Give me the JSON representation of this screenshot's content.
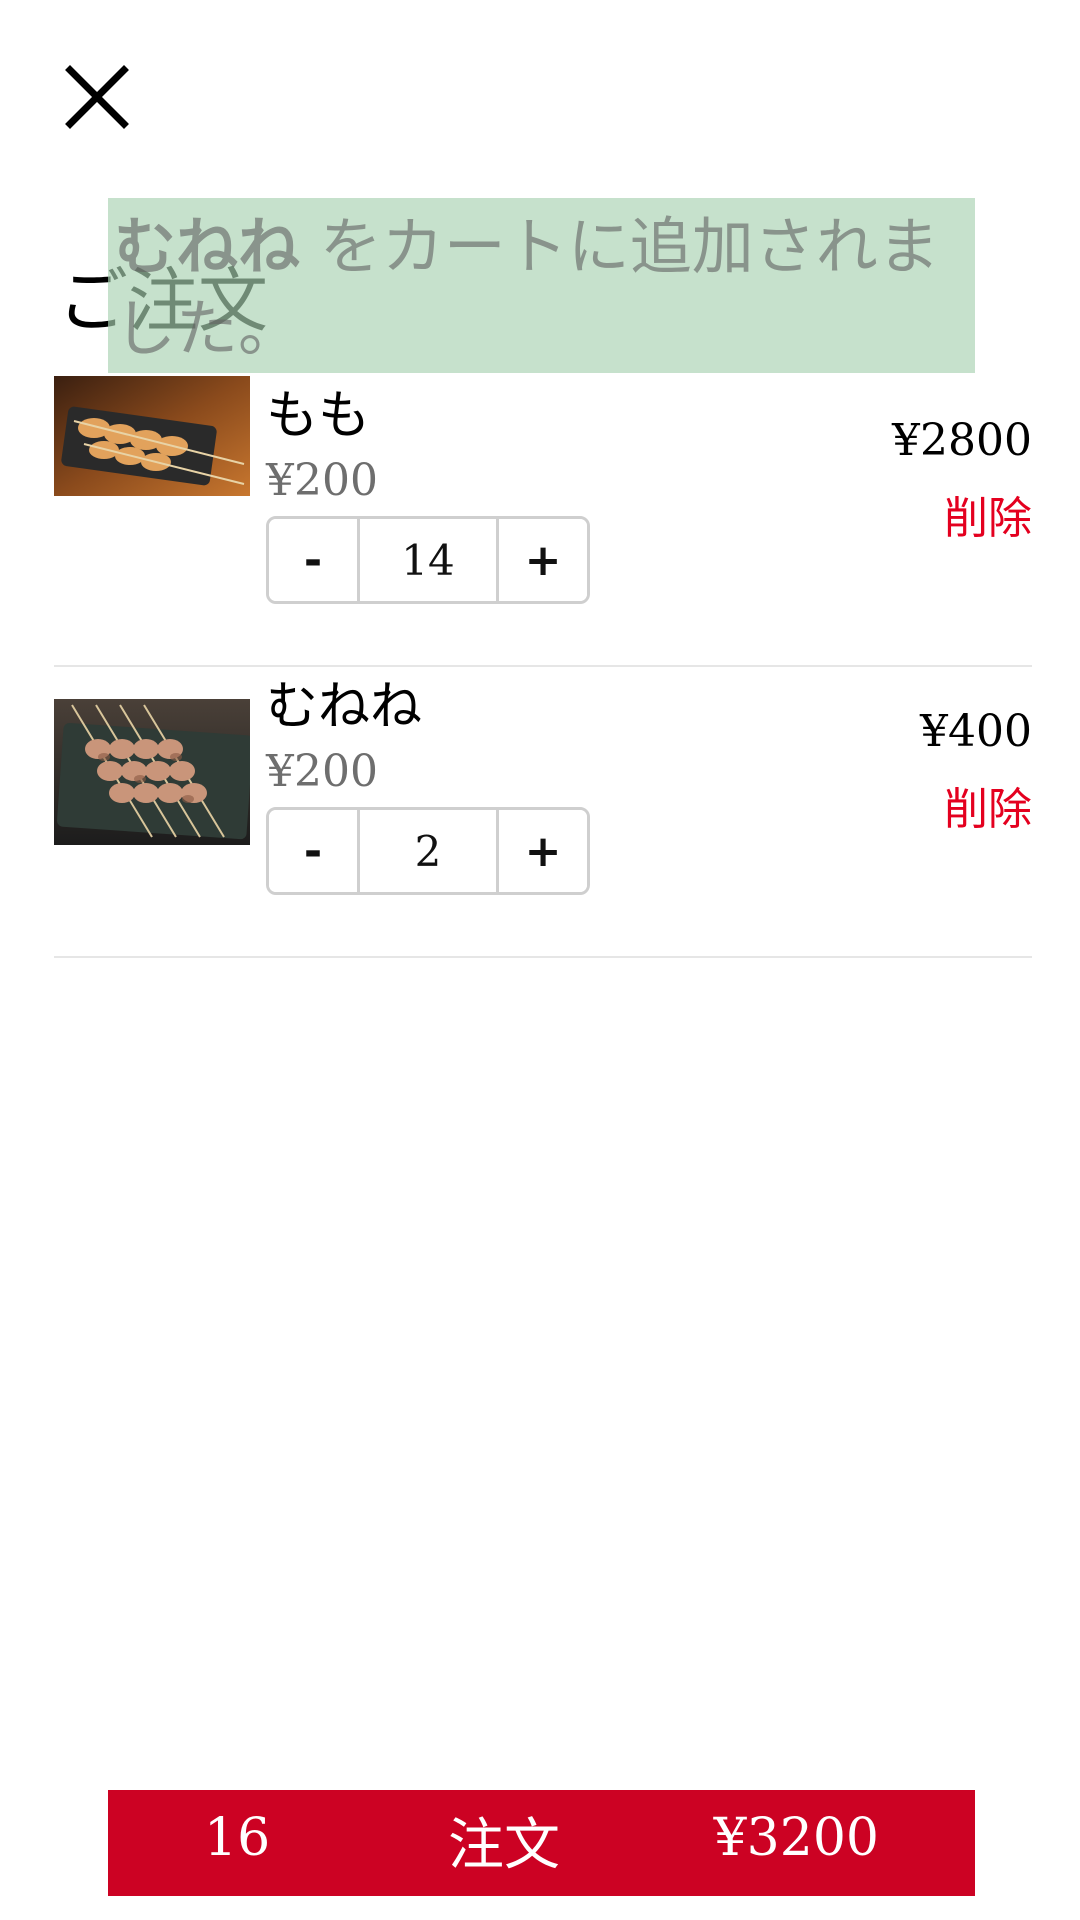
{
  "header": {
    "close_icon": "close-icon",
    "title": "ご注文"
  },
  "toast": {
    "item_name": "むねね",
    "message": " をカートに追加されました。",
    "background": "#a8d2b2"
  },
  "cart": {
    "items": [
      {
        "name": "もも",
        "unit_price": "¥200",
        "quantity": "14",
        "minus_label": "-",
        "plus_label": "+",
        "line_total": "¥2800",
        "delete_label": "削除",
        "image": "yakitori-momo-photo"
      },
      {
        "name": "むねね",
        "unit_price": "¥200",
        "quantity": "2",
        "minus_label": "-",
        "plus_label": "+",
        "line_total": "¥400",
        "delete_label": "削除",
        "image": "yakitori-mune-photo"
      }
    ]
  },
  "checkout": {
    "count": "16",
    "label": "注文",
    "total": "¥3200",
    "background": "#cc0223"
  },
  "colors": {
    "accent": "#cc0223",
    "delete": "#e4001f",
    "divider": "#e6e6e6"
  }
}
